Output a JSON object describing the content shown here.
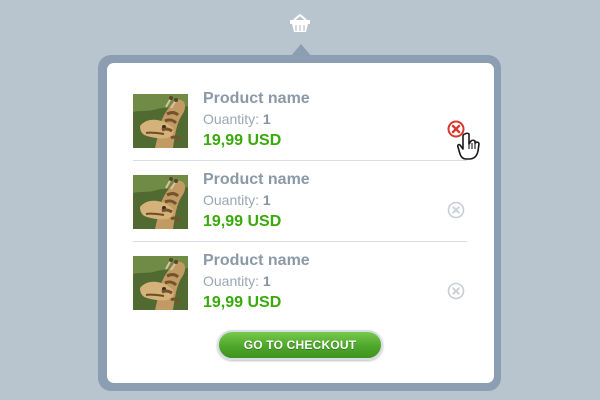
{
  "cart": {
    "items": [
      {
        "name": "Product name",
        "quantity_label": "Ouantity:",
        "quantity": "1",
        "price": "19,99 USD",
        "image_icon": "giraffe-photo",
        "remove_icon": "close-circle-icon",
        "remove_hovered": true
      },
      {
        "name": "Product name",
        "quantity_label": "Ouantity:",
        "quantity": "1",
        "price": "19,99 USD",
        "image_icon": "giraffe-photo",
        "remove_icon": "close-circle-icon",
        "remove_hovered": false
      },
      {
        "name": "Product name",
        "quantity_label": "Ouantity:",
        "quantity": "1",
        "price": "19,99 USD",
        "image_icon": "giraffe-photo",
        "remove_icon": "close-circle-icon",
        "remove_hovered": false
      }
    ],
    "checkout_label": "GO TO CHECKOUT"
  },
  "icons": {
    "basket": "basket-icon",
    "pointer": "hand-cursor-icon"
  },
  "colors": {
    "background": "#b8c5cf",
    "frame": "#8c9eb1",
    "product_text": "#8b99a7",
    "price": "#39a90b",
    "checkout_start": "#78c94b",
    "checkout_end": "#3f9220",
    "remove_hover": "#d93a2f",
    "remove_default": "#c7ced5"
  }
}
